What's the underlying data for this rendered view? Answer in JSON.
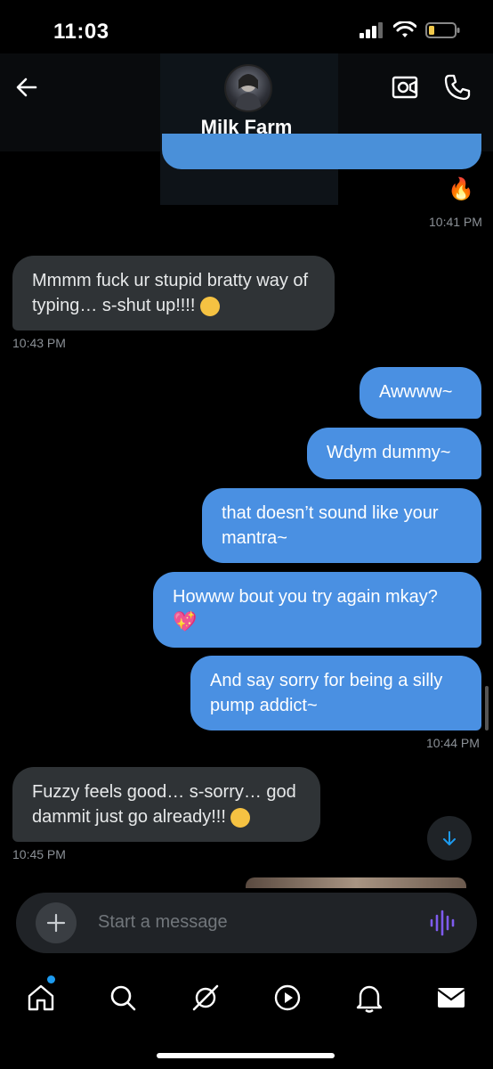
{
  "status": {
    "time": "11:03"
  },
  "header": {
    "title": "Milk Farm"
  },
  "messages": [
    {
      "text": "Mmmm fuck ur stupid bratty way of typing… s-shut up!!!!",
      "time": "10:43 PM"
    },
    {
      "text": "Awwww~"
    },
    {
      "text": "Wdym dummy~"
    },
    {
      "text": "that doesn’t sound like your mantra~"
    },
    {
      "text": "Howww bout you try again mkay?"
    },
    {
      "text": "And say sorry for being a silly pump addict~",
      "time": "10:44 PM"
    },
    {
      "text": "Fuzzy feels good… s-sorry… god dammit just go already!!!",
      "time": "10:45 PM"
    }
  ],
  "top_message_time": "10:41 PM",
  "composer": {
    "placeholder": "Start a message"
  },
  "tabs": [
    "home-icon",
    "search-icon",
    "grok-icon",
    "video-icon",
    "notifications-icon",
    "messages-icon"
  ],
  "colors": {
    "outgoing": "#4a90e2",
    "incoming": "#2f3336",
    "accent": "#1d9bf0"
  }
}
